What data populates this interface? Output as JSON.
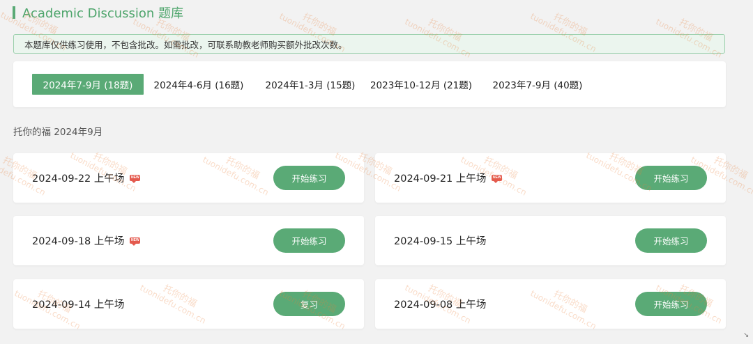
{
  "header": {
    "title": "Academic Discussion 题库"
  },
  "notice": {
    "text": "本题库仅供练习使用，不包含批改。如需批改，可联系助教老师购买额外批改次数。"
  },
  "tabs": [
    {
      "label": "2024年7-9月 (18题)",
      "active": true
    },
    {
      "label": "2024年4-6月 (16题)",
      "active": false
    },
    {
      "label": "2024年1-3月 (15题)",
      "active": false
    },
    {
      "label": "2023年10-12月 (21题)",
      "active": false
    },
    {
      "label": "2023年7-9月 (40题)",
      "active": false
    }
  ],
  "section": {
    "label": "托你的福 2024年9月"
  },
  "sessions": [
    {
      "date": "2024-09-22 上午场",
      "is_new": true,
      "button": "开始练习"
    },
    {
      "date": "2024-09-21 上午场",
      "is_new": true,
      "button": "开始练习"
    },
    {
      "date": "2024-09-18 上午场",
      "is_new": true,
      "button": "开始练习"
    },
    {
      "date": "2024-09-15 上午场",
      "is_new": false,
      "button": "开始练习"
    },
    {
      "date": "2024-09-14 上午场",
      "is_new": false,
      "button": "复习"
    },
    {
      "date": "2024-09-08 上午场",
      "is_new": false,
      "button": "开始练习"
    }
  ],
  "badge": {
    "new_text": "NEW"
  },
  "watermark": {
    "cn": "托你的福",
    "url": "tuonidefu.com.cn"
  },
  "colors": {
    "accent": "#5aaa76",
    "notice_bg": "#ebf5ee",
    "badge": "#e45a4e"
  }
}
